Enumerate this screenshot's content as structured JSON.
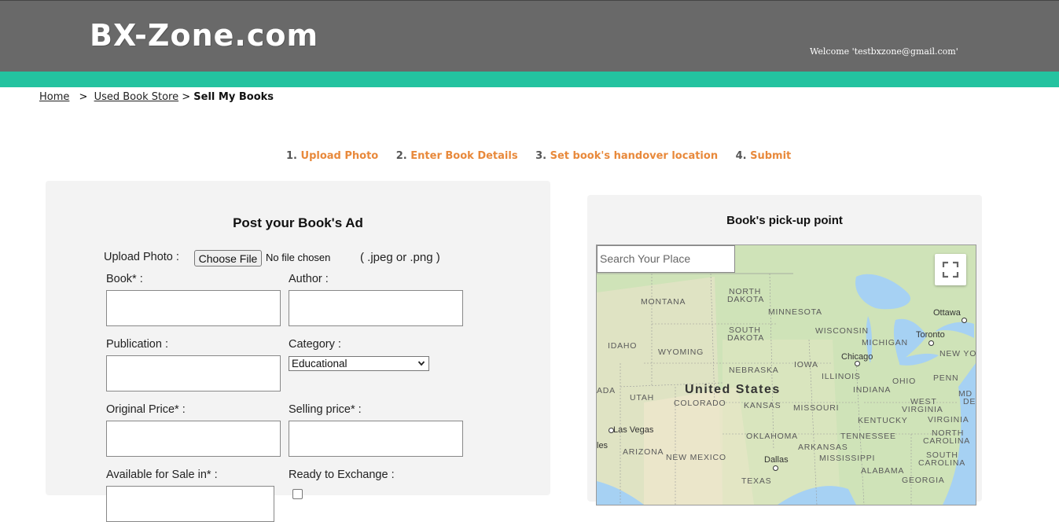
{
  "header": {
    "logo": "BX-Zone.com",
    "welcome": "Welcome 'testbxzone@gmail.com'"
  },
  "breadcrumb": {
    "home": "Home",
    "separator": ">",
    "store": "Used Book Store",
    "current": "Sell My Books"
  },
  "steps": [
    {
      "num": "1.",
      "label": "Upload Photo"
    },
    {
      "num": "2.",
      "label": "Enter Book Details"
    },
    {
      "num": "3.",
      "label": "Set book's handover location"
    },
    {
      "num": "4.",
      "label": "Submit"
    }
  ],
  "form": {
    "title": "Post your Book's Ad",
    "upload_label": "Upload Photo :",
    "upload_button": "Choose File",
    "upload_status": "No file chosen",
    "upload_hint": "( .jpeg or .png )",
    "book_label": "Book* :",
    "author_label": "Author :",
    "publication_label": "Publication :",
    "category_label": "Category :",
    "category_value": "Educational",
    "original_price_label": "Original Price* :",
    "selling_price_label": "Selling price* :",
    "available_label": "Available for Sale in* :",
    "exchange_label": "Ready to Exchange :"
  },
  "map": {
    "title": "Book's pick-up point",
    "search_placeholder": "Search Your Place",
    "labels": {
      "montana": "MONTANA",
      "north_dakota_1": "NORTH",
      "north_dakota_2": "DAKOTA",
      "minnesota": "MINNESOTA",
      "south_dakota_1": "SOUTH",
      "south_dakota_2": "DAKOTA",
      "wisconsin": "WISCONSIN",
      "michigan": "MICHIGAN",
      "idaho": "IDAHO",
      "wyoming": "WYOMING",
      "nebraska": "NEBRASKA",
      "iowa": "IOWA",
      "illinois": "ILLINOIS",
      "indiana": "INDIANA",
      "ohio": "OHIO",
      "penn": "PENN",
      "new_york": "NEW YO",
      "nevada": "ADA",
      "utah": "UTAH",
      "colorado": "COLORADO",
      "kansas": "KANSAS",
      "missouri": "MISSOURI",
      "west_virginia_1": "WEST",
      "west_virginia_2": "VIRGINIA",
      "virginia": "VIRGINIA",
      "kentucky": "KENTUCKY",
      "md": "MD",
      "de": "DE",
      "oklahoma": "OKLAHOMA",
      "tennessee": "TENNESSEE",
      "north_carolina_1": "NORTH",
      "north_carolina_2": "CAROLINA",
      "arizona": "ARIZONA",
      "new_mexico": "NEW MEXICO",
      "arkansas": "ARKANSAS",
      "mississippi": "MISSISSIPPI",
      "south_carolina_1": "SOUTH",
      "south_carolina_2": "CAROLINA",
      "alabama": "ALABAMA",
      "georgia": "GEORGIA",
      "texas": "TEXAS",
      "country": "United States",
      "ottawa": "Ottawa",
      "toronto": "Toronto",
      "chicago": "Chicago",
      "las_vegas": "Las Vegas",
      "angeles": "les",
      "dallas": "Dallas"
    }
  },
  "colors": {
    "header": "#696969",
    "teal": "#24c3a0",
    "step_label": "#e8893b",
    "panel": "#f3f3f3"
  }
}
